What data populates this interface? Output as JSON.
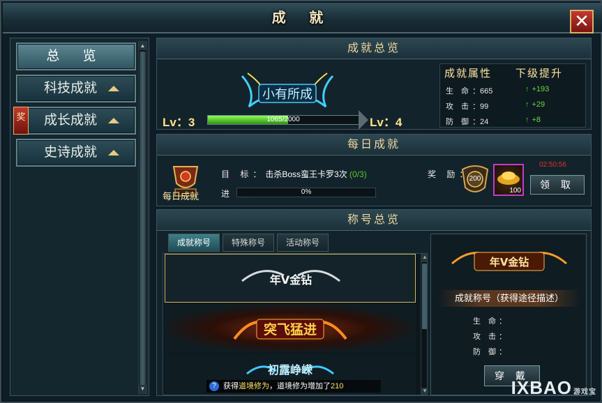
{
  "window": {
    "title": "成 就",
    "close_glyph": "✕"
  },
  "nav": {
    "items": [
      {
        "label": "总 览",
        "active": true
      },
      {
        "label": "科技成就"
      },
      {
        "label": "成长成就",
        "badge": "奖"
      },
      {
        "label": "史诗成就"
      }
    ]
  },
  "overview": {
    "header": "成就总览",
    "rank_title": "小有所成",
    "level_current": "Lv：3",
    "level_next": "Lv：4",
    "progress_text": "1065/2000",
    "progress_fraction": 0.5325,
    "attr_header": "成就属性",
    "next_header": "下级提升",
    "stats": [
      {
        "label": "生 命",
        "value": "665",
        "gain": "+193"
      },
      {
        "label": "攻 击",
        "value": "99",
        "gain": "+29"
      },
      {
        "label": "防 御",
        "value": "24",
        "gain": "+8"
      }
    ]
  },
  "daily": {
    "header": "每日成就",
    "badge_label": "每日成就",
    "target_key": "目 标：",
    "target_text": "击杀Boss蛮王卡罗3次",
    "target_progress": "(0/3)",
    "progress_key": "进 度：",
    "progress_text": "0%",
    "reward_key": "奖 励：",
    "reward_medal": "200",
    "reward_gold": "100",
    "timer": "02:50:56",
    "claim_label": "领 取"
  },
  "titles": {
    "header": "称号总览",
    "tabs": [
      "成就称号",
      "特殊称号",
      "活动称号"
    ],
    "list": [
      {
        "name": "年V金钻"
      },
      {
        "name": "突飞猛进"
      },
      {
        "name": "初露峥嵘"
      }
    ],
    "detail": {
      "title_art": "年V金钻",
      "desc": "成就称号（获得途径描述）",
      "stats": [
        "生 命：",
        "攻 击：",
        "防 御："
      ],
      "wear_label": "穿 戴"
    }
  },
  "notice": {
    "prefix": "获得",
    "hl": "道境修为",
    "mid": "，道境修为增加了",
    "num": "210"
  },
  "watermark": {
    "text": "IXBAO",
    "sub": "游戏宝"
  },
  "colors": {
    "accent_gold": "#f0d7a0",
    "progress_green": "#3fa81e",
    "close_red": "#b52a1f",
    "gain_green": "#6cdc3c",
    "timer_red": "#e0302a"
  }
}
